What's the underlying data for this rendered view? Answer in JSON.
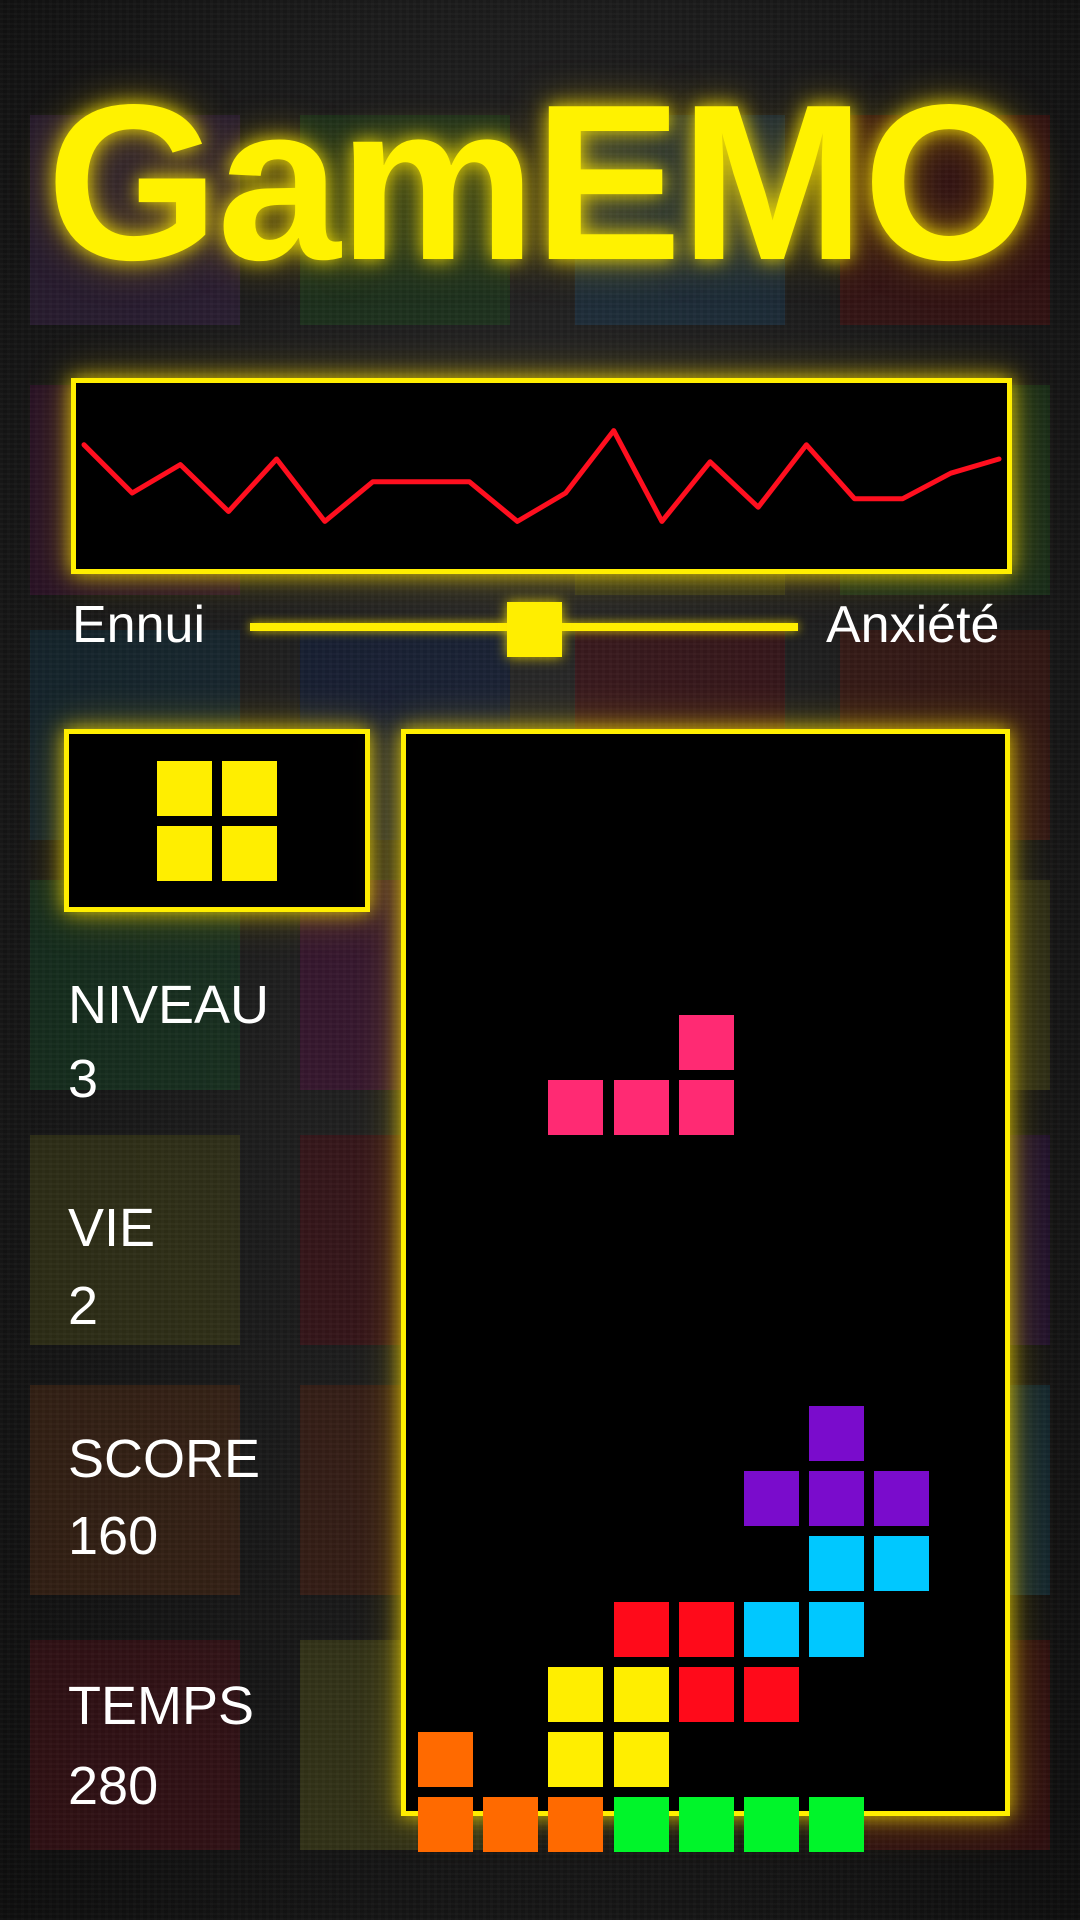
{
  "title": "GamEMO",
  "emotion_meter": {
    "left_label": "Ennui",
    "right_label": "Anxiété",
    "level": 0.52,
    "trace": [
      0.72,
      0.38,
      0.58,
      0.25,
      0.62,
      0.18,
      0.46,
      0.46,
      0.46,
      0.18,
      0.38,
      0.82,
      0.18,
      0.6,
      0.28,
      0.72,
      0.34,
      0.34,
      0.52,
      0.62
    ]
  },
  "stats": {
    "level_label": "NIVEAU",
    "level_value": "3",
    "life_label": "VIE",
    "life_value": "2",
    "score_label": "SCORE",
    "score_value": "160",
    "time_label": "TEMPS",
    "time_value": "280"
  },
  "colors": {
    "accent": "#ffee00",
    "trace": "#ff0f1f",
    "pink": "#ff2a73",
    "purple": "#7a0ccc",
    "cyan": "#00c8ff",
    "red": "#ff0a1a",
    "yellow": "#ffee00",
    "orange": "#ff6a00",
    "green": "#00f52a"
  },
  "next_piece": {
    "name": "O",
    "color": "yellow",
    "cells": [
      [
        0,
        0
      ],
      [
        1,
        0
      ],
      [
        0,
        1
      ],
      [
        1,
        1
      ]
    ]
  },
  "board": {
    "columns": 9,
    "rows": 16,
    "active_piece": {
      "name": "L",
      "color": "pink",
      "cells": [
        [
          4,
          4
        ],
        [
          2,
          5
        ],
        [
          3,
          5
        ],
        [
          4,
          5
        ]
      ]
    },
    "settled": [
      {
        "col": 6,
        "row": 10,
        "color": "purple"
      },
      {
        "col": 5,
        "row": 11,
        "color": "purple"
      },
      {
        "col": 6,
        "row": 11,
        "color": "purple"
      },
      {
        "col": 7,
        "row": 11,
        "color": "purple"
      },
      {
        "col": 6,
        "row": 12,
        "color": "cyan"
      },
      {
        "col": 7,
        "row": 12,
        "color": "cyan"
      },
      {
        "col": 5,
        "row": 13,
        "color": "cyan"
      },
      {
        "col": 6,
        "row": 13,
        "color": "cyan"
      },
      {
        "col": 3,
        "row": 13,
        "color": "red"
      },
      {
        "col": 4,
        "row": 13,
        "color": "red"
      },
      {
        "col": 4,
        "row": 14,
        "color": "red"
      },
      {
        "col": 5,
        "row": 14,
        "color": "red"
      },
      {
        "col": 2,
        "row": 14,
        "color": "yellow"
      },
      {
        "col": 3,
        "row": 14,
        "color": "yellow"
      },
      {
        "col": 2,
        "row": 15,
        "color": "yellow"
      },
      {
        "col": 3,
        "row": 15,
        "color": "yellow"
      },
      {
        "col": 0,
        "row": 15,
        "color": "orange"
      },
      {
        "col": 0,
        "row": 16,
        "color": "orange"
      },
      {
        "col": 1,
        "row": 16,
        "color": "orange"
      },
      {
        "col": 2,
        "row": 16,
        "color": "orange"
      },
      {
        "col": 3,
        "row": 16,
        "color": "green"
      },
      {
        "col": 4,
        "row": 16,
        "color": "green"
      },
      {
        "col": 5,
        "row": 16,
        "color": "green"
      },
      {
        "col": 6,
        "row": 16,
        "color": "green"
      }
    ]
  }
}
